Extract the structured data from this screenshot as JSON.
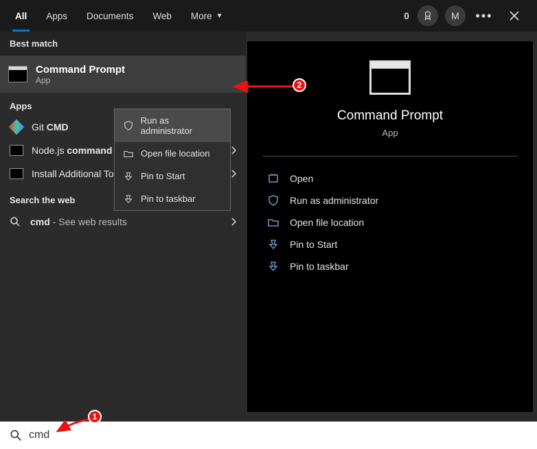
{
  "tabs": {
    "items": [
      "All",
      "Apps",
      "Documents",
      "Web",
      "More"
    ],
    "active_index": 0
  },
  "header": {
    "points": "0",
    "user_initial": "M"
  },
  "best_match": {
    "label": "Best match",
    "title": "Command Prompt",
    "subtitle": "App"
  },
  "apps_section": {
    "label": "Apps",
    "items": [
      {
        "label_pre": "Git",
        "label_bold": "CMD",
        "icon": "git"
      },
      {
        "label_pre": "Node.js",
        "label_bold": "command",
        "icon": "cmd",
        "has_chevron": true
      },
      {
        "label_full": "Install Additional Tools for Node.js",
        "icon": "cmd",
        "has_chevron": true
      }
    ]
  },
  "web_section": {
    "label": "Search the web",
    "query": "cmd",
    "suffix": " - See web results"
  },
  "context_menu": {
    "items": [
      {
        "label": "Run as administrator",
        "icon": "shield"
      },
      {
        "label": "Open file location",
        "icon": "folder"
      },
      {
        "label": "Pin to Start",
        "icon": "pin"
      },
      {
        "label": "Pin to taskbar",
        "icon": "pin"
      }
    ]
  },
  "detail_panel": {
    "title": "Command Prompt",
    "subtitle": "App",
    "actions": [
      {
        "label": "Open",
        "icon": "open"
      },
      {
        "label": "Run as administrator",
        "icon": "shield"
      },
      {
        "label": "Open file location",
        "icon": "folder"
      },
      {
        "label": "Pin to Start",
        "icon": "pin"
      },
      {
        "label": "Pin to taskbar",
        "icon": "pin"
      }
    ]
  },
  "search": {
    "value": "cmd"
  },
  "annotations": {
    "badge1": "1",
    "badge2": "2"
  }
}
